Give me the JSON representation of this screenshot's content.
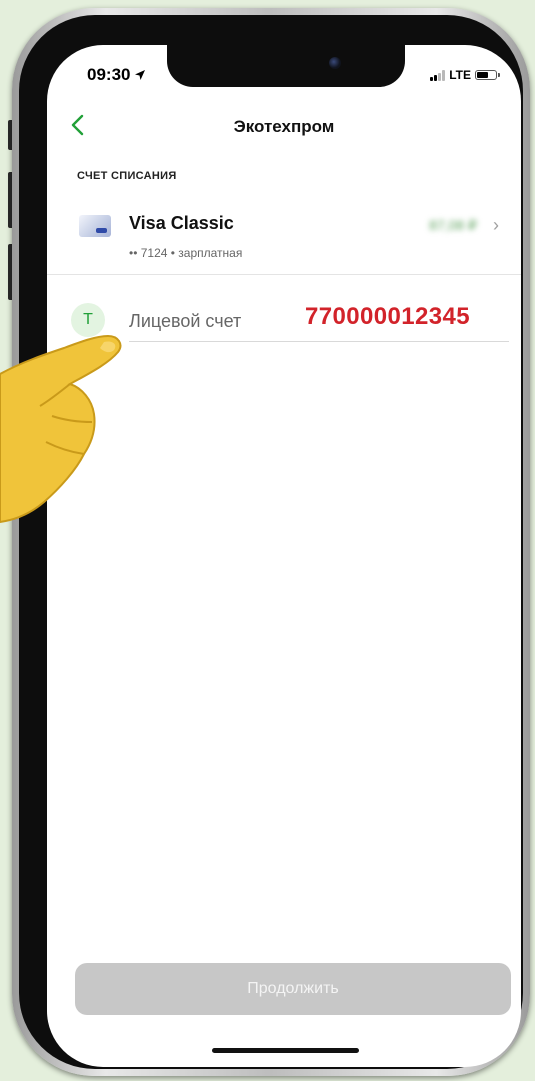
{
  "status_bar": {
    "time": "09:30",
    "network": "LTE"
  },
  "nav": {
    "title": "Экотехпром"
  },
  "debit_account": {
    "section_label": "СЧЕТ СПИСАНИЯ",
    "card_name": "Visa Classic",
    "card_details": "•• 7124 • зарплатная",
    "balance_obscured": "87,08 ₽"
  },
  "account_field": {
    "icon_letter": "Т",
    "label": "Лицевой счет",
    "value": "770000012345"
  },
  "actions": {
    "continue_label": "Продолжить"
  },
  "icons": [
    "location-arrow-icon",
    "signal-icon",
    "battery-icon",
    "back-chevron-icon",
    "card-icon",
    "chevron-right-icon",
    "pointing-hand-icon"
  ],
  "colors": {
    "background": "#e4efdc",
    "accent_green": "#21a038",
    "value_red": "#d2232a",
    "disabled_button": "#c7c7c7"
  }
}
